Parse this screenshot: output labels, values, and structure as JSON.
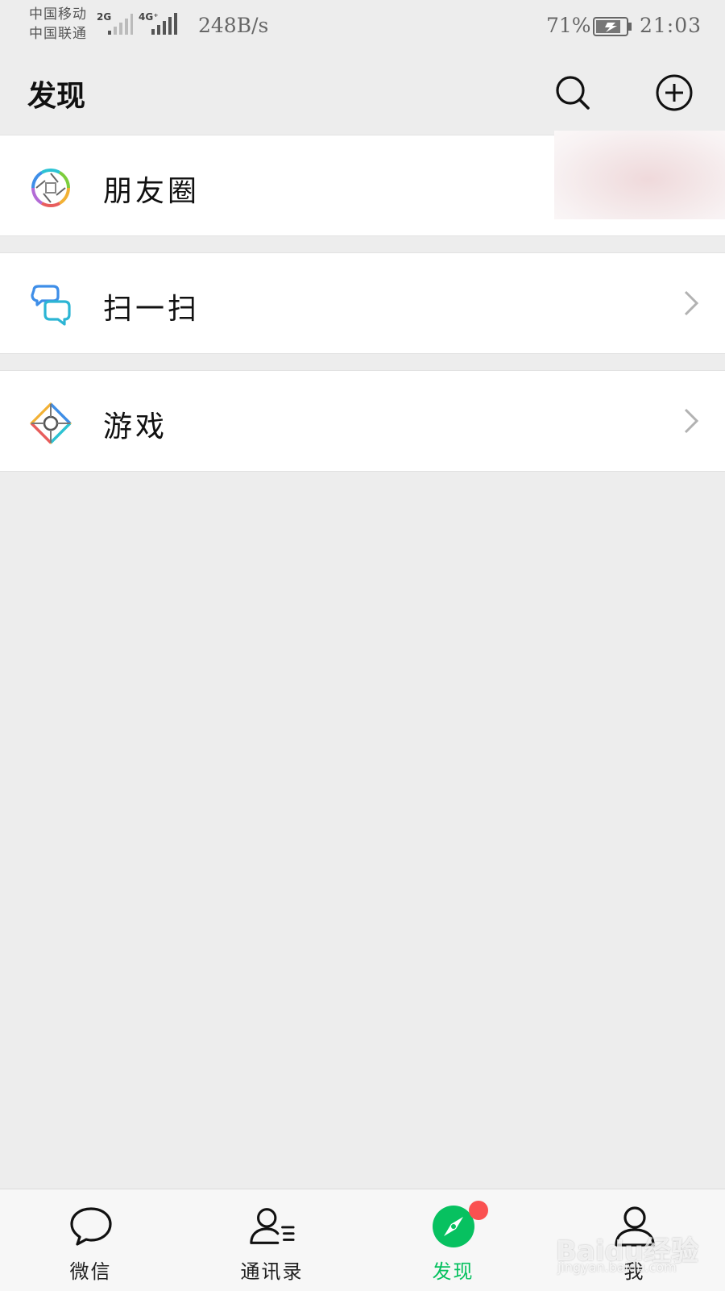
{
  "status_bar": {
    "carrier_1": "中国移动",
    "carrier_2": "中国联通",
    "net_1": "2G",
    "net_2": "4G⁺",
    "speed": "248B/s",
    "battery": "71%",
    "time": "21:03"
  },
  "header": {
    "title": "发现",
    "search_icon": "search-icon",
    "add_icon": "plus-circle-icon"
  },
  "list": {
    "moments": {
      "label": "朋友圈",
      "icon": "moments-aperture-icon"
    },
    "scan": {
      "label": "扫一扫",
      "icon": "scan-icon"
    },
    "games": {
      "label": "游戏",
      "icon": "games-icon"
    }
  },
  "tabbar": {
    "tabs": [
      {
        "label": "微信",
        "icon": "chat-bubble-icon",
        "active": false
      },
      {
        "label": "通讯录",
        "icon": "contacts-icon",
        "active": false
      },
      {
        "label": "发现",
        "icon": "compass-icon",
        "active": true
      },
      {
        "label": "我",
        "icon": "person-icon",
        "active": false
      }
    ]
  },
  "watermark": {
    "main": "Baidu经验",
    "sub": "jingyan.baidu.com"
  },
  "colors": {
    "accent": "#07c160",
    "badge": "#fa5151",
    "background": "#ededed"
  }
}
